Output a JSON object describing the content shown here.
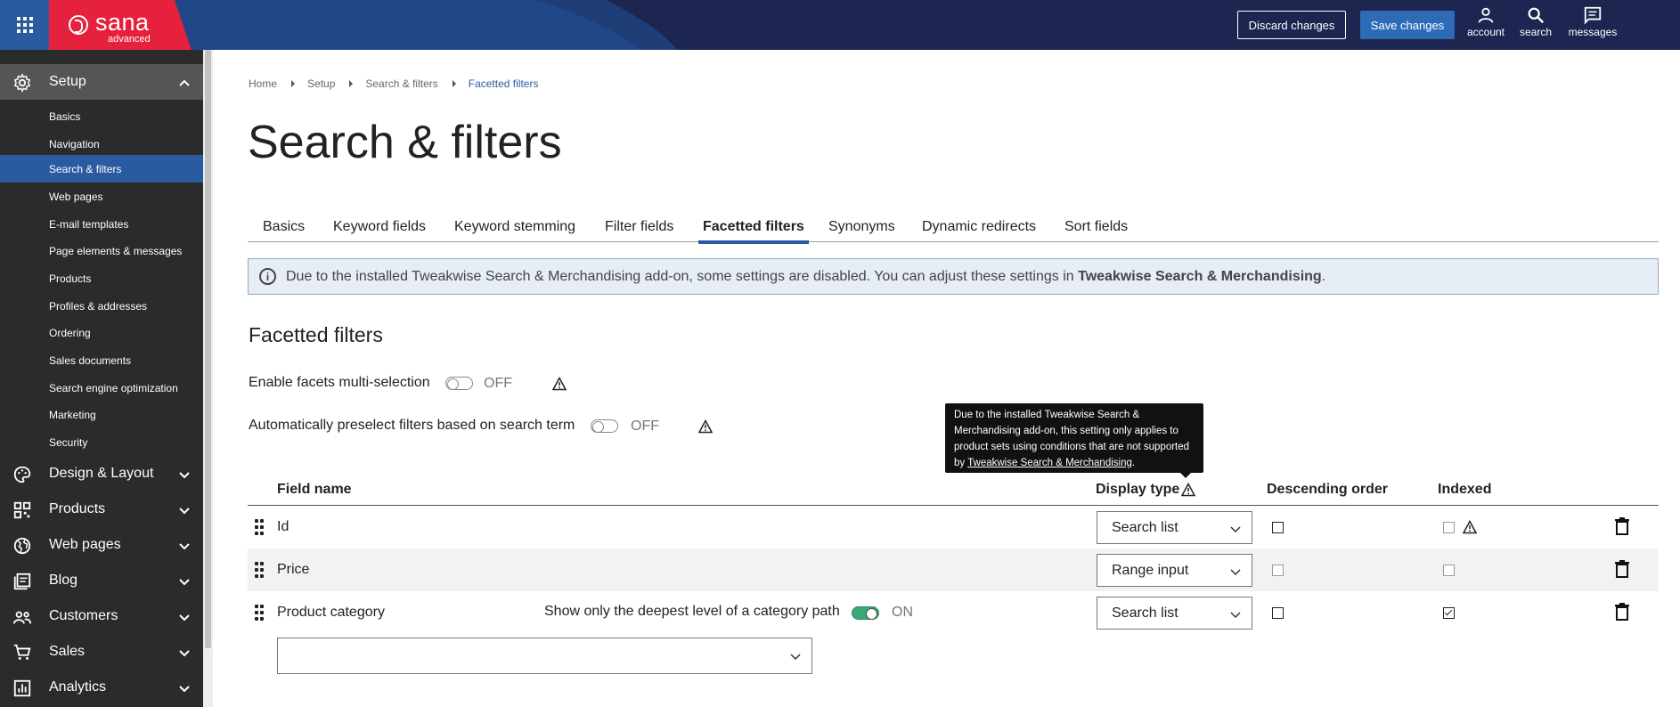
{
  "brand": {
    "name": "sana",
    "edition": "advanced"
  },
  "topbar": {
    "discard_label": "Discard changes",
    "save_label": "Save changes",
    "account_label": "account",
    "search_label": "search",
    "messages_label": "messages"
  },
  "sidebar": {
    "setup_label": "Setup",
    "setup_items": [
      "Basics",
      "Navigation",
      "Search & filters",
      "Web pages",
      "E-mail templates",
      "Page elements & messages",
      "Products",
      "Profiles & addresses",
      "Ordering",
      "Sales documents",
      "Search engine optimization",
      "Marketing",
      "Security"
    ],
    "active_item": "Search & filters",
    "sections": [
      "Design & Layout",
      "Products",
      "Web pages",
      "Blog",
      "Customers",
      "Sales",
      "Analytics"
    ]
  },
  "breadcrumb": [
    "Home",
    "Setup",
    "Search & filters",
    "Facetted filters"
  ],
  "page_title": "Search & filters",
  "tabs": [
    "Basics",
    "Keyword fields",
    "Keyword stemming",
    "Filter fields",
    "Facetted filters",
    "Synonyms",
    "Dynamic redirects",
    "Sort fields"
  ],
  "active_tab": "Facetted filters",
  "notice": {
    "text": "Due to the installed Tweakwise Search & Merchandising add-on, some settings are disabled. You can adjust these settings in ",
    "link": "Tweakwise Search & Merchandising",
    "end": "."
  },
  "section_title": "Facetted filters",
  "settings": {
    "multi_selection": {
      "label": "Enable facets multi-selection",
      "state": "OFF"
    },
    "preselect": {
      "label": "Automatically preselect filters based on search term",
      "state": "OFF"
    }
  },
  "tooltip": {
    "text": "Due to the installed Tweakwise Search & Merchandising add-on, this setting only applies to product sets using conditions that are not supported by ",
    "link": "Tweakwise Search & Merchandising",
    "end": "."
  },
  "table": {
    "headers": {
      "field_name": "Field name",
      "display_type": "Display type",
      "descending": "Descending order",
      "indexed": "Indexed"
    },
    "rows": [
      {
        "name": "Id",
        "display_type": "Search list",
        "descending": false,
        "indexed": false
      },
      {
        "name": "Price",
        "display_type": "Range input",
        "descending": false,
        "indexed": false
      },
      {
        "name": "Product category",
        "display_type": "Search list",
        "descending": false,
        "indexed": true,
        "extra_label": "Show only the deepest level of a category path",
        "extra_state": "ON"
      }
    ]
  },
  "colors": {
    "topbar": "#1c2651",
    "brand_red": "#e5213d",
    "accent_blue": "#2a5aa0",
    "toggle_on": "#3aa877"
  }
}
